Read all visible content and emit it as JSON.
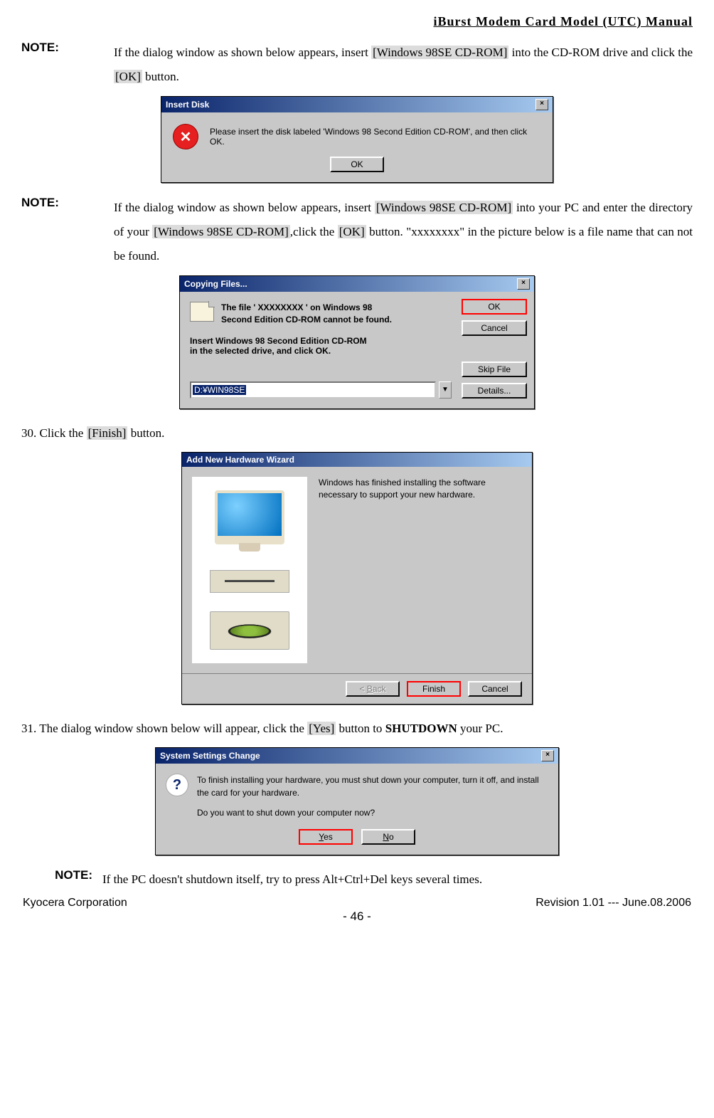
{
  "header": {
    "title": "iBurst Modem Card Model (UTC) Manual"
  },
  "note1": {
    "label": "NOTE:",
    "pre": "If the dialog window as shown below appears, insert ",
    "hl1": "[Windows 98SE CD-ROM]",
    "mid": " into the CD-ROM drive and click the ",
    "hl2": "[OK]",
    "post": " button."
  },
  "dialog1": {
    "title": "Insert Disk",
    "icon_glyph": "✕",
    "message": "Please insert the disk labeled 'Windows 98 Second Edition CD-ROM', and then click OK.",
    "ok": "OK"
  },
  "note2": {
    "label": "NOTE:",
    "pre": "If the dialog window as shown below appears, insert ",
    "hl1": "[Windows 98SE CD-ROM]",
    "mid1": " into your PC and enter the directory of your ",
    "hl2": "[Windows 98SE CD-ROM]",
    "mid2": ",click the ",
    "hl3": "[OK]",
    "post": " button.  \"xxxxxxxx\" in the picture below is a file name that can not be found."
  },
  "dialog2": {
    "title": "Copying Files...",
    "msg1a": "The file ' XXXXXXXX ' on Windows 98",
    "msg1b": "Second Edition CD-ROM cannot be found.",
    "msg2a": "Insert Windows 98 Second Edition CD-ROM",
    "msg2b": "in the selected drive, and click OK.",
    "input_value": "D:¥WIN98SE",
    "buttons": {
      "ok": "OK",
      "cancel": "Cancel",
      "skip": "Skip File",
      "details": "Details..."
    }
  },
  "step30": {
    "pre": "30. Click the ",
    "hl": "[Finish]",
    "post": " button."
  },
  "dialog3": {
    "title": "Add New Hardware Wizard",
    "msg": "Windows has finished installing the software necessary to support your new hardware.",
    "back_html": "< <u>B</u>ack",
    "finish": "Finish",
    "cancel": "Cancel"
  },
  "step31": {
    "pre": "31. The dialog window shown below will appear, click the ",
    "hl": "[Yes]",
    "mid": " button to ",
    "bold": "SHUTDOWN",
    "post": " your PC."
  },
  "dialog4": {
    "title": "System Settings Change",
    "icon_glyph": "?",
    "msg1": "To finish installing your hardware, you must shut down your computer, turn it off, and install the card for your hardware.",
    "msg2": "Do you want to shut down your computer now?",
    "yes_html": "<u>Y</u>es",
    "no_html": "<u>N</u>o"
  },
  "note3": {
    "label": "NOTE:",
    "text": "If the PC doesn't shutdown itself, try to press Alt+Ctrl+Del keys several times."
  },
  "footer": {
    "left": "Kyocera Corporation",
    "center": "- 46 -",
    "right": "Revision 1.01 --- June.08.2006"
  }
}
